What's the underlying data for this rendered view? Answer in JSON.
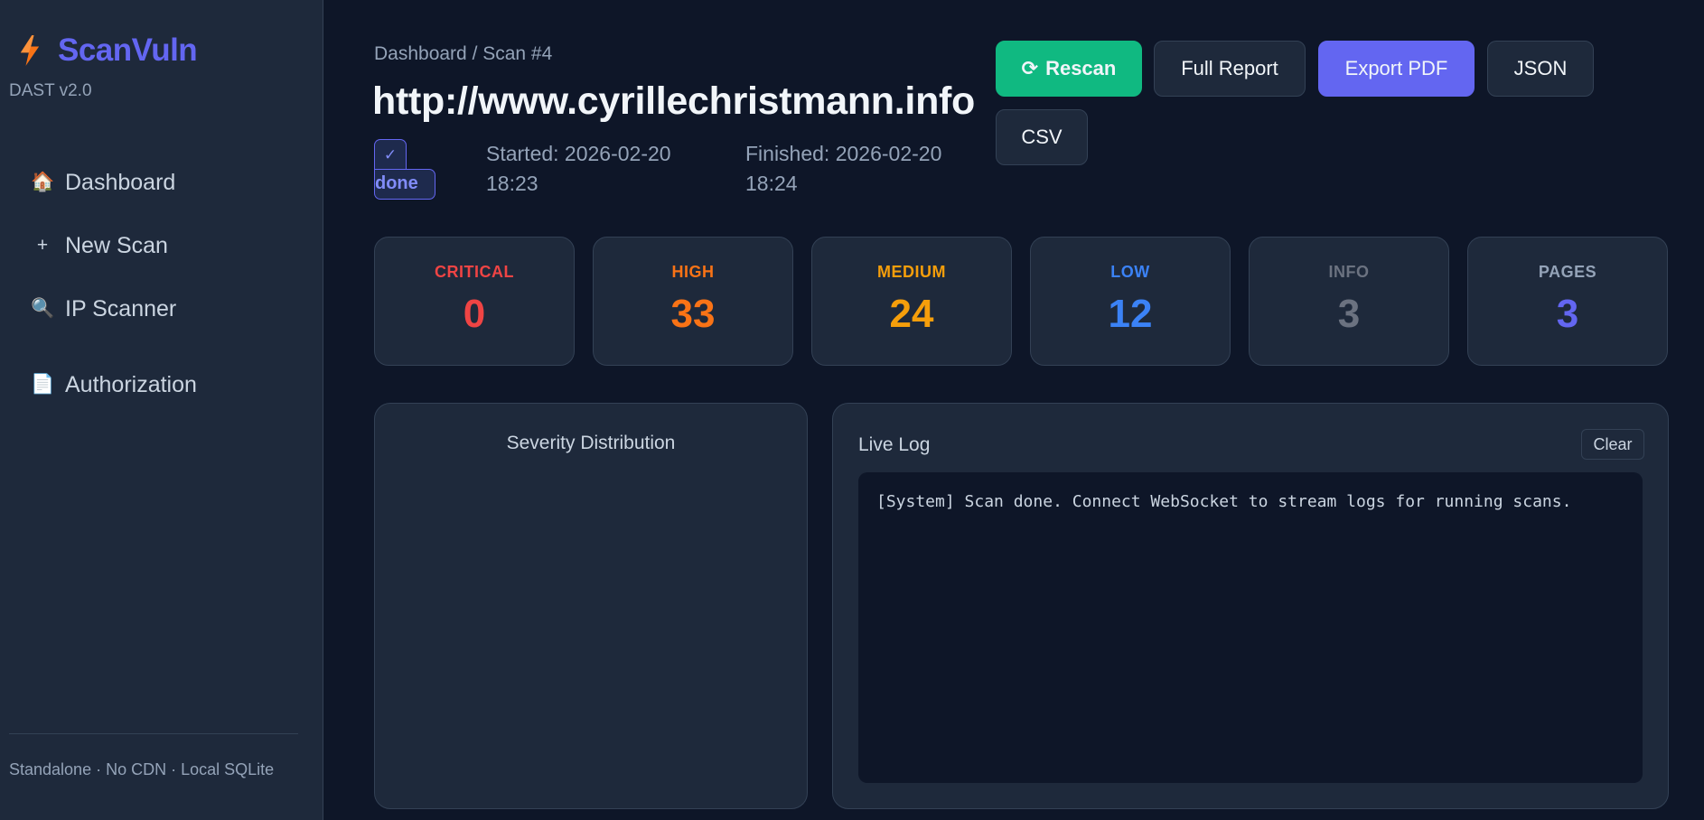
{
  "brand": {
    "name": "ScanVuln",
    "version": "DAST v2.0",
    "icon": "lightning-bolt-icon",
    "accent": "#6366f1"
  },
  "sidebar": {
    "items": [
      {
        "icon": "house-icon",
        "glyph": "🏠",
        "label": "Dashboard"
      },
      {
        "icon": "plus-icon",
        "glyph": "+",
        "label": "New Scan"
      },
      {
        "icon": "magnifier-icon",
        "glyph": "🔍",
        "label": "IP Scanner"
      },
      {
        "icon": "document-icon",
        "glyph": "📄",
        "label": "Authorization"
      }
    ],
    "footer": "Standalone · No CDN · Local SQLite"
  },
  "header": {
    "breadcrumb": "Dashboard / Scan #4",
    "title": "http://www.cyrillechristmann.info",
    "status": "done",
    "started": "Started: 2026-02-20 18:23",
    "finished": "Finished: 2026-02-20 18:24"
  },
  "actions": {
    "rescan": "Rescan",
    "full_report": "Full Report",
    "export_pdf": "Export PDF",
    "json": "JSON",
    "csv": "CSV"
  },
  "stats": [
    {
      "label": "CRITICAL",
      "value": "0",
      "color": "#ef4444"
    },
    {
      "label": "HIGH",
      "value": "33",
      "color": "#f97316"
    },
    {
      "label": "MEDIUM",
      "value": "24",
      "color": "#f59e0b"
    },
    {
      "label": "LOW",
      "value": "12",
      "color": "#3b82f6"
    },
    {
      "label": "INFO",
      "value": "3",
      "color": "#6b7280"
    },
    {
      "label": "PAGES",
      "value": "3",
      "color": "#6366f1"
    }
  ],
  "severity_panel": {
    "title": "Severity Distribution"
  },
  "log_panel": {
    "title": "Live Log",
    "clear": "Clear",
    "lines": [
      "[System] Scan done. Connect WebSocket to stream logs for running scans."
    ]
  }
}
